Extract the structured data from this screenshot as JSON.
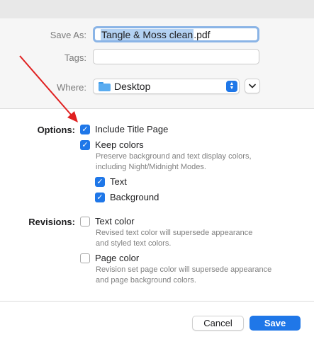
{
  "form": {
    "save_as_label": "Save As:",
    "filename_selected": "Tangle & Moss clean",
    "filename_ext": ".pdf",
    "tags_label": "Tags:",
    "tags_value": "",
    "where_label": "Where:",
    "where_value": "Desktop"
  },
  "options": {
    "label": "Options:",
    "include_title_page": {
      "label": "Include Title Page",
      "checked": true
    },
    "keep_colors": {
      "label": "Keep colors",
      "checked": true,
      "desc_line1": "Preserve background and text display colors,",
      "desc_line2": "including Night/Midnight Modes."
    },
    "text": {
      "label": "Text",
      "checked": true
    },
    "background": {
      "label": "Background",
      "checked": true
    }
  },
  "revisions": {
    "label": "Revisions:",
    "text_color": {
      "label": "Text color",
      "checked": false,
      "desc_line1": "Revised text color will supersede appearance",
      "desc_line2": "and styled text colors."
    },
    "page_color": {
      "label": "Page color",
      "checked": false,
      "desc_line1": "Revision set page color will supersede appearance",
      "desc_line2": "and page background colors."
    }
  },
  "buttons": {
    "cancel": "Cancel",
    "save": "Save"
  },
  "icons": {
    "where": "folder-icon",
    "stepper": "chevron-up-down-icon",
    "expand": "chevron-down-icon",
    "check": "checkmark-icon"
  },
  "colors": {
    "accent": "#1f77e8",
    "annotation_arrow": "#e02020"
  }
}
